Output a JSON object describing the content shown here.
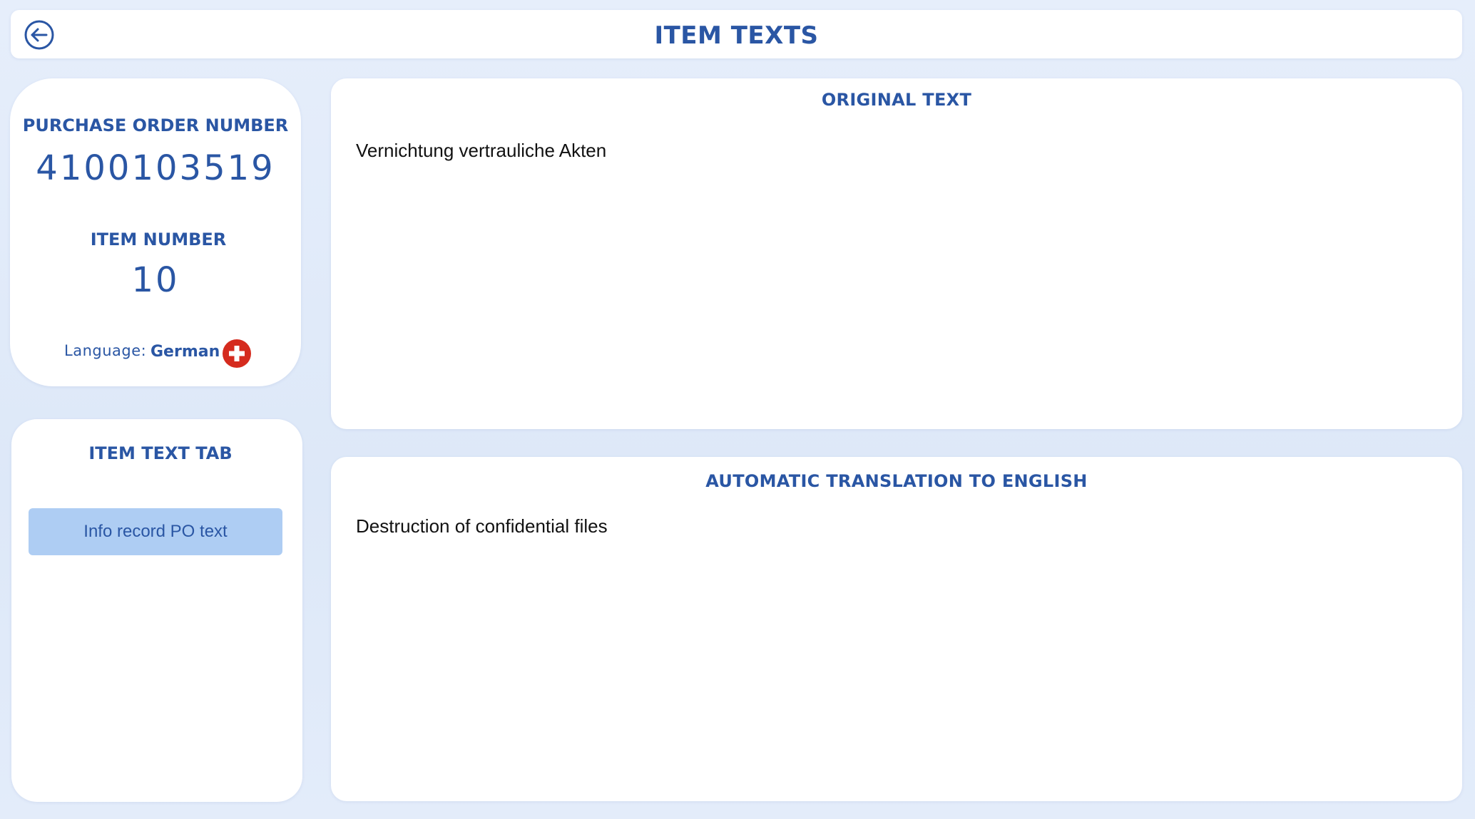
{
  "header": {
    "title": "ITEM TEXTS",
    "back_icon": "arrow-left-circle-icon"
  },
  "po_card": {
    "po_label": "PURCHASE ORDER NUMBER",
    "po_number": "4100103519",
    "item_label": "ITEM NUMBER",
    "item_number": "10",
    "language_label": "Language:",
    "language_value": "German",
    "flag_icon": "swiss-flag-icon"
  },
  "tab_card": {
    "title": "ITEM TEXT TAB",
    "tabs": [
      {
        "label": "Info record PO text",
        "selected": true
      }
    ]
  },
  "original": {
    "title": "ORIGINAL TEXT",
    "text": "Vernichtung vertrauliche Akten"
  },
  "translation": {
    "title": "AUTOMATIC TRANSLATION TO ENGLISH",
    "text": "Destruction of confidential files"
  },
  "colors": {
    "accent": "#2a56a4",
    "tab_selected_bg": "#aecdf3",
    "background": "#e3ecfa",
    "flag_red": "#d52b1e"
  }
}
